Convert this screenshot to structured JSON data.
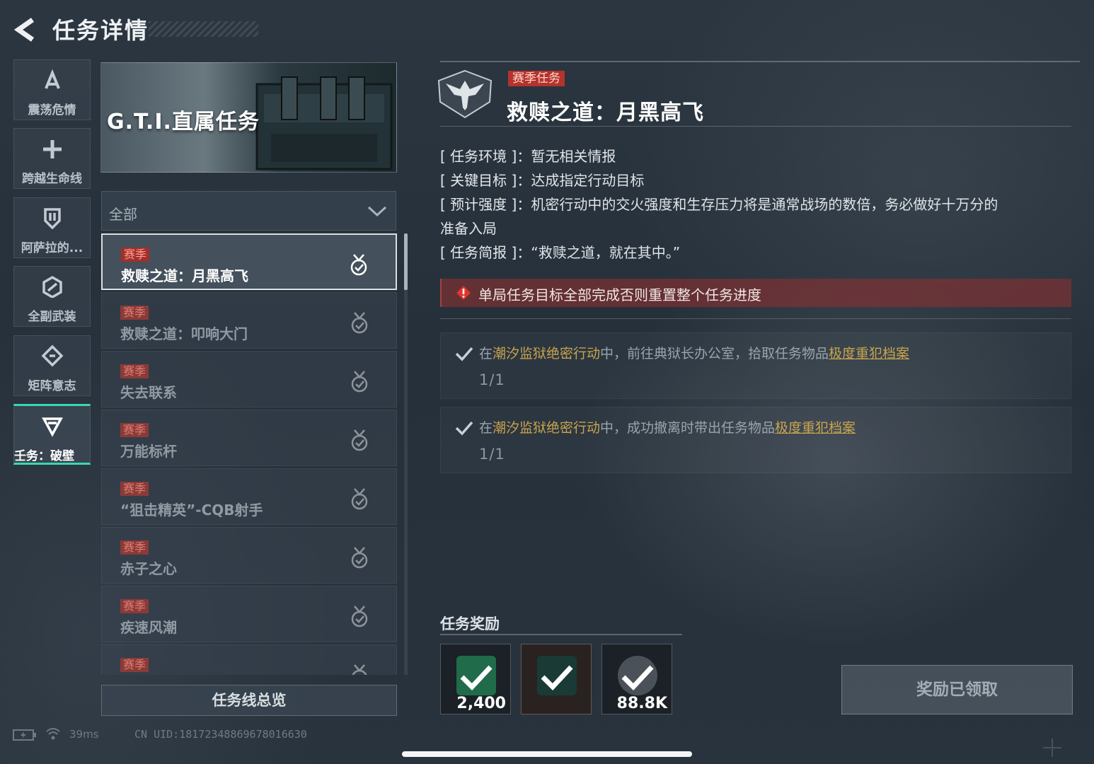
{
  "header": {
    "title": "任务详情"
  },
  "categories": [
    {
      "label": "震荡危情",
      "icon": "chevron-a-icon",
      "active": false
    },
    {
      "label": "跨越生命线",
      "icon": "plus-cross-icon",
      "active": false
    },
    {
      "label": "阿萨拉的...",
      "icon": "shield-icon",
      "active": false
    },
    {
      "label": "全副武装",
      "icon": "hexagon-link-icon",
      "active": false
    },
    {
      "label": "矩阵意志",
      "icon": "diamond-arrows-icon",
      "active": false
    },
    {
      "label": "壬务：破壁",
      "icon": "triangle-v-icon",
      "active": true
    }
  ],
  "banner": {
    "title": "G.T.I.直属任务"
  },
  "filter": {
    "selected": "全部"
  },
  "missions": [
    {
      "tag": "赛季",
      "name": "救赎之道：月黑高飞",
      "selected": true
    },
    {
      "tag": "赛季",
      "name": "救赎之道：叩响大门",
      "selected": false
    },
    {
      "tag": "赛季",
      "name": "失去联系",
      "selected": false
    },
    {
      "tag": "赛季",
      "name": "万能标杆",
      "selected": false
    },
    {
      "tag": "赛季",
      "name": "“狙击精英”-CQB射手",
      "selected": false
    },
    {
      "tag": "赛季",
      "name": "赤子之心",
      "selected": false
    },
    {
      "tag": "赛季",
      "name": "疾速风潮",
      "selected": false
    },
    {
      "tag": "赛季",
      "name": "",
      "selected": false
    }
  ],
  "overview_button": "任务线总览",
  "status_bar": {
    "ping": "39ms",
    "uid": "CN UID:18172348869678016630"
  },
  "detail": {
    "tag": "赛季任务",
    "title": "救赎之道：月黑高飞",
    "info": {
      "env_key": "[ 任务环境 ]：",
      "env_val": "暂无相关情报",
      "goal_key": "[ 关键目标 ]：",
      "goal_val": "达成指定行动目标",
      "strength_key": "[ 预计强度 ]：",
      "strength_val": "机密行动中的交火强度和生存压力将是通常战场的数倍，务必做好十万分的",
      "strength_val2": "准备入局",
      "brief_key": "[ 任务简报 ]：",
      "brief_val": "“救赎之道，就在其中。”"
    },
    "warning": "单局任务目标全部完成否则重置整个任务进度",
    "objectives": [
      {
        "pre": "在",
        "location": "潮汐监狱绝密行动",
        "mid": "中，前往典狱长办公室，拾取任务物品",
        "item": "极度重犯档案",
        "progress": "1/1"
      },
      {
        "pre": "在",
        "location": "潮汐监狱绝密行动",
        "mid": "中，成功撤离时带出任务物品",
        "item": "极度重犯档案",
        "progress": "1/1"
      }
    ]
  },
  "rewards": {
    "title": "任务奖励",
    "items": [
      {
        "qty": "2,400",
        "icon": "badge-icon"
      },
      {
        "qty": "",
        "icon": "gear-case-icon"
      },
      {
        "qty": "88.8K",
        "icon": "coin-icon"
      }
    ],
    "claimed_label": "奖励已领取"
  },
  "colors": {
    "accent": "#38d8b0",
    "season_tag": "#b3332d",
    "gold": "#c9a44d"
  }
}
